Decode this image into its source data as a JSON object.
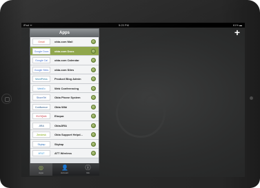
{
  "status_bar": {
    "carrier": "iPad ᯤ",
    "time": "5:23 PM",
    "battery": "61% ▬"
  },
  "header": {
    "title": "Apps",
    "add_label": "+"
  },
  "apps": [
    {
      "name": "okta.com Mail",
      "logo": "Gmail",
      "logo_color": "#d44638"
    },
    {
      "name": "okta.com Docs",
      "logo": "Google Docs",
      "logo_color": "#3b6ac9"
    },
    {
      "name": "okta.com Calendar",
      "logo": "Google Cal",
      "logo_color": "#3b6ac9"
    },
    {
      "name": "okta.com Sites",
      "logo": "Google Sites",
      "logo_color": "#3b6ac9"
    },
    {
      "name": "Product Blog Admin",
      "logo": "WordPress",
      "logo_color": "#21759b"
    },
    {
      "name": "Web Conferencing",
      "logo": "WebEx",
      "logo_color": "#3a86c8"
    },
    {
      "name": "Okta Phone System",
      "logo": "ShoreTel",
      "logo_color": "#2c5aa0"
    },
    {
      "name": "Okta Wiki",
      "logo": "Confluence",
      "logo_color": "#205081"
    },
    {
      "name": "Eloqua",
      "logo": "ELOQUA",
      "logo_color": "#c0202f"
    },
    {
      "name": "OktaJIRA",
      "logo": "JIRA",
      "logo_color": "#205081"
    },
    {
      "name": "Okta Support Helpd...",
      "logo": "Zendesk",
      "logo_color": "#78a300"
    },
    {
      "name": "Skytap",
      "logo": "Skytap",
      "logo_color": "#2a6ebb"
    },
    {
      "name": "ATT Wireless",
      "logo": "AT&T",
      "logo_color": "#1f8dd6"
    }
  ],
  "selected_index": 1,
  "tabs": [
    {
      "label": "Apps",
      "icon": "◎"
    },
    {
      "label": "Account",
      "icon": "👤"
    },
    {
      "label": "Info",
      "icon": "ⓘ"
    }
  ],
  "active_tab_index": 0,
  "colors": {
    "selected_row": "#8fa64a",
    "header": "#5e6265"
  }
}
